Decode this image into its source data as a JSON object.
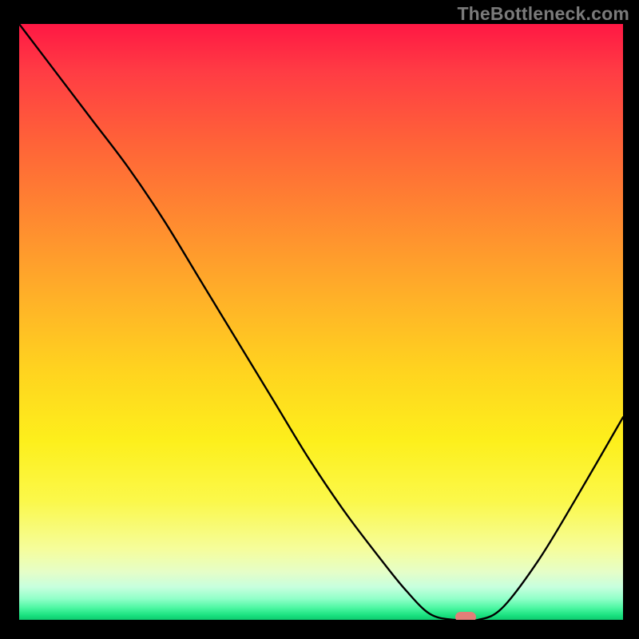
{
  "watermark": "TheBottleneck.com",
  "chart_data": {
    "type": "line",
    "title": "",
    "xlabel": "",
    "ylabel": "",
    "xlim": [
      0,
      100
    ],
    "ylim": [
      0,
      100
    ],
    "grid": false,
    "legend": false,
    "background_gradient": [
      {
        "pos": 0,
        "color": "#ff1844"
      },
      {
        "pos": 0.08,
        "color": "#ff3c44"
      },
      {
        "pos": 0.2,
        "color": "#ff6338"
      },
      {
        "pos": 0.33,
        "color": "#ff8a30"
      },
      {
        "pos": 0.46,
        "color": "#ffb128"
      },
      {
        "pos": 0.58,
        "color": "#ffd31f"
      },
      {
        "pos": 0.7,
        "color": "#fdef1c"
      },
      {
        "pos": 0.8,
        "color": "#fbf84a"
      },
      {
        "pos": 0.88,
        "color": "#f6fd9a"
      },
      {
        "pos": 0.92,
        "color": "#e5fec8"
      },
      {
        "pos": 0.945,
        "color": "#c7ffde"
      },
      {
        "pos": 0.965,
        "color": "#8fffc8"
      },
      {
        "pos": 0.98,
        "color": "#4cf7a2"
      },
      {
        "pos": 0.993,
        "color": "#18e07e"
      },
      {
        "pos": 1.0,
        "color": "#0fc96f"
      }
    ],
    "series": [
      {
        "name": "bottleneck-curve",
        "color": "#000000",
        "x": [
          0,
          6,
          12,
          18,
          24,
          30,
          36,
          42,
          48,
          54,
          60,
          64,
          68,
          72,
          76,
          80,
          86,
          92,
          100
        ],
        "y": [
          100,
          92,
          84,
          76,
          67,
          57,
          47,
          37,
          27,
          18,
          10,
          5,
          1,
          0,
          0,
          2,
          10,
          20,
          34
        ]
      }
    ],
    "marker": {
      "x": 74,
      "y": 0.5,
      "color": "#e27f78"
    }
  }
}
